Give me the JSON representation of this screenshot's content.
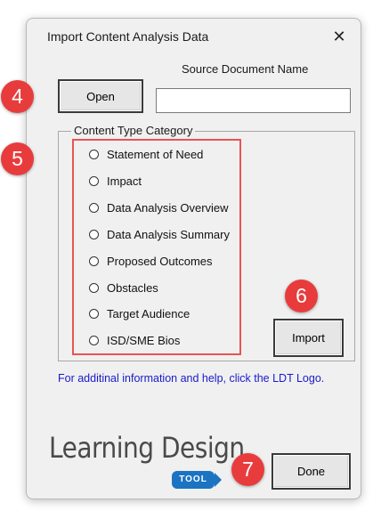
{
  "window": {
    "title": "Import Content Analysis Data",
    "close_glyph": "✕"
  },
  "source": {
    "label": "Source Document Name",
    "value": "",
    "open_label": "Open"
  },
  "category": {
    "label": "Content Type Category",
    "options": [
      "Statement of Need",
      "Impact",
      "Data Analysis Overview",
      "Data Analysis Summary",
      "Proposed Outcomes",
      "Obstacles",
      "Target Audience",
      "ISD/SME Bios"
    ],
    "selected": null
  },
  "import_label": "Import",
  "help_text": "For additinal information and help, click the LDT Logo.",
  "logo": {
    "text": "Learning Design",
    "badge": "TOOL"
  },
  "done_label": "Done",
  "steps": [
    "4",
    "5",
    "6",
    "7"
  ],
  "colors": {
    "step_badge": "#e83c3c",
    "highlight_border": "#e85454",
    "help_link": "#1a1acc",
    "tool_badge": "#1b73c2"
  }
}
